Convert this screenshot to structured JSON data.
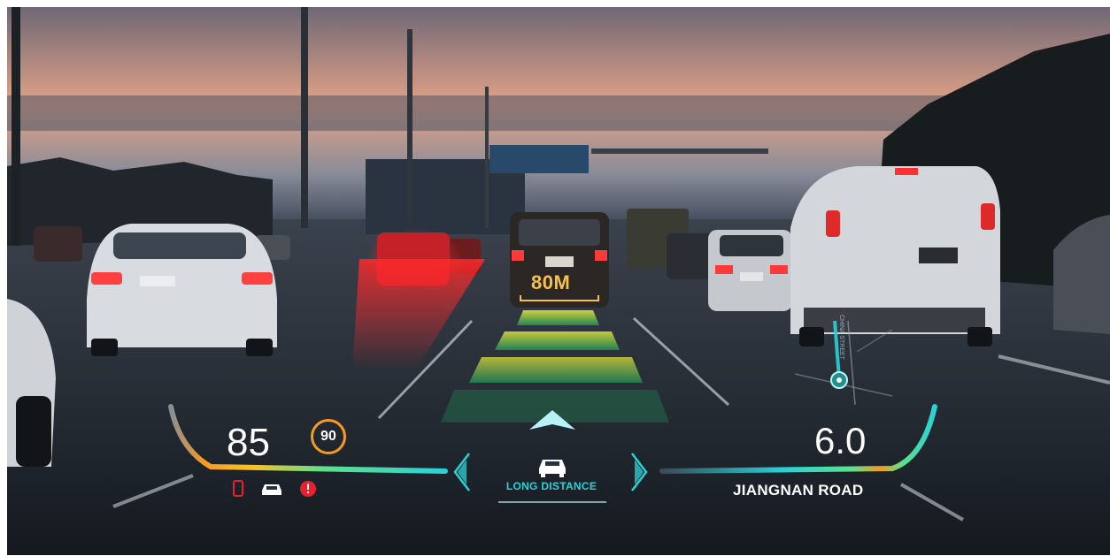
{
  "hud": {
    "speed": "85",
    "speed_limit": "90",
    "lead_vehicle_distance": "80M",
    "drive_mode": "LONG DISTANCE",
    "next_turn_distance": "6.0",
    "road_name": "JIANGNAN ROAD",
    "map_street_label": "CHINA STREET",
    "status_icons": [
      "phone-icon",
      "car-icon",
      "alert-icon"
    ],
    "mode_icons": [
      "chevron-left-icon",
      "car-front-icon",
      "chevron-right-icon"
    ],
    "navigation_icon": "nav-arrow-icon"
  },
  "colors": {
    "hud_cyan": "#28d2d9",
    "gauge_yellow": "#f5c22a",
    "gauge_orange": "#f59a23",
    "distance_amber": "#f7c04a",
    "lane_green": "#4dd66b",
    "alert_red": "#e8212e",
    "sky_top": "#7e7280",
    "sky_horizon": "#e9a882",
    "road": "#1c2228"
  }
}
